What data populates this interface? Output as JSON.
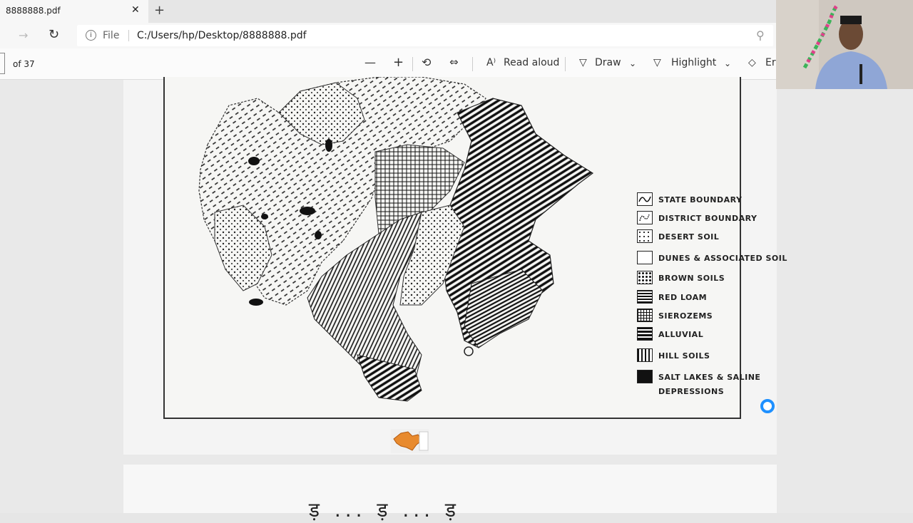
{
  "tab": {
    "title": "8888888.pdf"
  },
  "address": {
    "scheme_label": "File",
    "url": "C:/Users/hp/Desktop/8888888.pdf"
  },
  "toolbar": {
    "page_of": "of 37",
    "read_aloud": "Read aloud",
    "draw": "Draw",
    "highlight": "Highlight",
    "erase": "Era"
  },
  "map": {
    "legend": [
      {
        "label": "STATE BOUNDARY",
        "pattern": "wave"
      },
      {
        "label": "DISTRICT BOUNDARY",
        "pattern": "squiggle"
      },
      {
        "label": "DESERT SOIL",
        "pattern": "dots-sparse"
      },
      {
        "label": "DUNES & ASSOCIATED SOIL",
        "pattern": "blank"
      },
      {
        "label": "BROWN SOILS",
        "pattern": "dots-dense"
      },
      {
        "label": "RED LOAM",
        "pattern": "horizontal"
      },
      {
        "label": "SIEROZEMS",
        "pattern": "grid"
      },
      {
        "label": "ALLUVIAL",
        "pattern": "thick-horizontal"
      },
      {
        "label": "HILL SOILS",
        "pattern": "vertical"
      },
      {
        "label": "SALT LAKES & SALINE",
        "pattern": "solid"
      }
    ],
    "legend_extra": "DEPRESSIONS"
  },
  "page2": {
    "text": "ड़ ... ड़ ... ड़"
  },
  "colors": {
    "accent": "#1e90ff",
    "chrome": "#f7f7f7"
  }
}
